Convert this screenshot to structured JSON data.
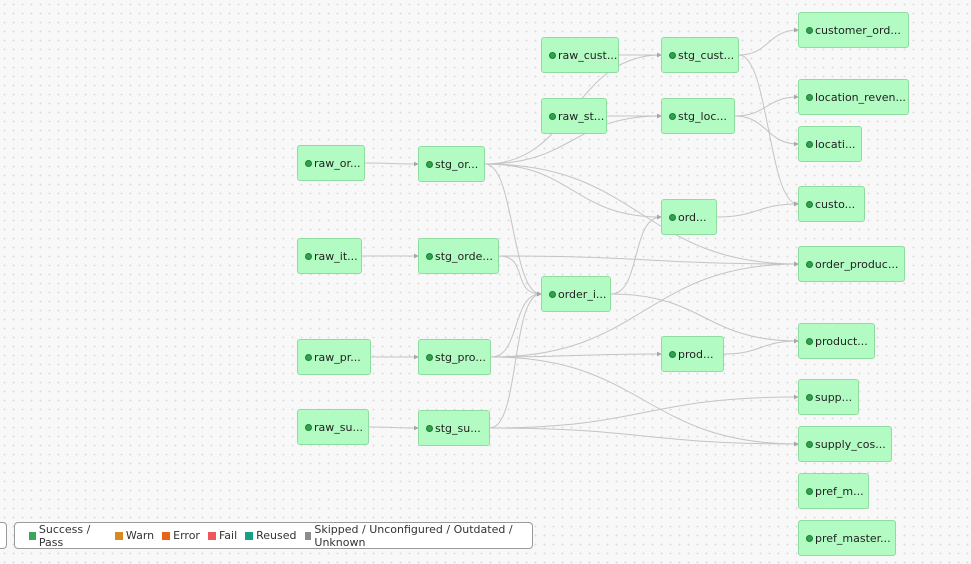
{
  "colors": {
    "node_fill": "#b2fcc3",
    "node_border": "#8fdca0",
    "status_dot": "#2fa24b",
    "edge": "#c4c4c4"
  },
  "nodes": [
    {
      "id": "raw_orders",
      "label": "raw_or..."
    },
    {
      "id": "raw_items",
      "label": "raw_it..."
    },
    {
      "id": "raw_products",
      "label": "raw_pr..."
    },
    {
      "id": "raw_supplies",
      "label": "raw_su..."
    },
    {
      "id": "stg_orders",
      "label": "stg_or..."
    },
    {
      "id": "stg_order_items",
      "label": "stg_orde..."
    },
    {
      "id": "stg_products",
      "label": "stg_pro..."
    },
    {
      "id": "stg_supplies",
      "label": "stg_su..."
    },
    {
      "id": "raw_customers",
      "label": "raw_cust..."
    },
    {
      "id": "raw_stores",
      "label": "raw_st..."
    },
    {
      "id": "order_items",
      "label": "order_i..."
    },
    {
      "id": "stg_customers",
      "label": "stg_cust..."
    },
    {
      "id": "stg_locations",
      "label": "stg_loc..."
    },
    {
      "id": "orders",
      "label": "ord..."
    },
    {
      "id": "products",
      "label": "prod..."
    },
    {
      "id": "customer_orders",
      "label": "customer_ord..."
    },
    {
      "id": "location_revenue",
      "label": "location_reven..."
    },
    {
      "id": "locations",
      "label": "locati..."
    },
    {
      "id": "customers",
      "label": "custo..."
    },
    {
      "id": "order_products",
      "label": "order_produc..."
    },
    {
      "id": "product_x",
      "label": "product..."
    },
    {
      "id": "supplies",
      "label": "supp..."
    },
    {
      "id": "supply_costs",
      "label": "supply_cos..."
    },
    {
      "id": "pref_m",
      "label": "pref_m..."
    },
    {
      "id": "pref_master",
      "label": "pref_master..."
    }
  ],
  "edges": [
    [
      "raw_orders",
      "stg_orders"
    ],
    [
      "raw_items",
      "stg_order_items"
    ],
    [
      "raw_products",
      "stg_products"
    ],
    [
      "raw_supplies",
      "stg_supplies"
    ],
    [
      "raw_customers",
      "stg_customers"
    ],
    [
      "raw_stores",
      "stg_locations"
    ],
    [
      "stg_orders",
      "stg_customers"
    ],
    [
      "stg_orders",
      "stg_locations"
    ],
    [
      "stg_orders",
      "orders"
    ],
    [
      "stg_orders",
      "order_items"
    ],
    [
      "stg_orders",
      "order_products"
    ],
    [
      "stg_order_items",
      "order_items"
    ],
    [
      "stg_order_items",
      "order_products"
    ],
    [
      "stg_products",
      "order_items"
    ],
    [
      "stg_products",
      "products"
    ],
    [
      "stg_products",
      "order_products"
    ],
    [
      "stg_products",
      "supply_costs"
    ],
    [
      "stg_supplies",
      "order_items"
    ],
    [
      "stg_supplies",
      "supplies"
    ],
    [
      "stg_supplies",
      "supply_costs"
    ],
    [
      "order_items",
      "orders"
    ],
    [
      "order_items",
      "product_x"
    ],
    [
      "stg_customers",
      "customer_orders"
    ],
    [
      "stg_customers",
      "customers"
    ],
    [
      "stg_locations",
      "location_revenue"
    ],
    [
      "stg_locations",
      "locations"
    ],
    [
      "orders",
      "customers"
    ],
    [
      "products",
      "product_x"
    ]
  ],
  "legend": [
    {
      "label": "Success / Pass",
      "color": "#3ba55c"
    },
    {
      "label": "Warn",
      "color": "#d98a1c"
    },
    {
      "label": "Error",
      "color": "#e8631a"
    },
    {
      "label": "Fail",
      "color": "#f0565a"
    },
    {
      "label": "Reused",
      "color": "#16a085"
    },
    {
      "label": "Skipped / Unconfigured / Outdated / Unknown",
      "color": "#8d8d8d"
    }
  ]
}
